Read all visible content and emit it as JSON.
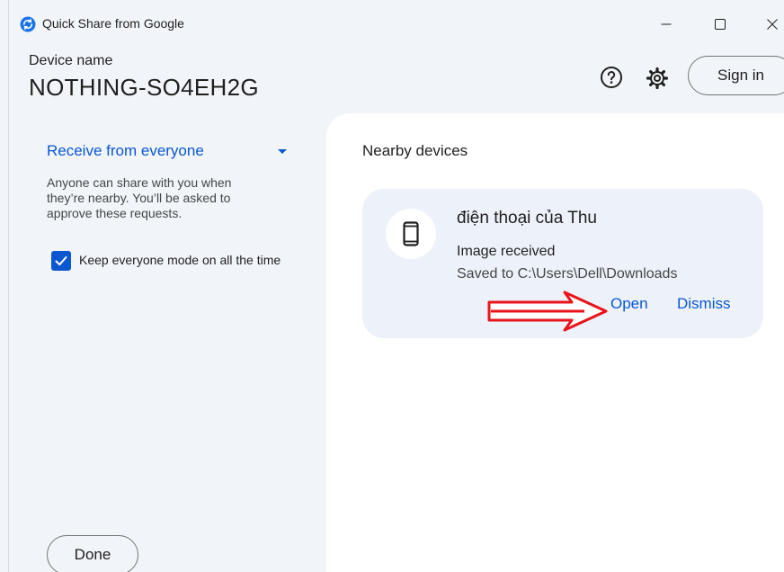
{
  "window": {
    "title": "Quick Share from Google",
    "controls": {
      "minimize": "—",
      "maximize": "☐",
      "close": "✕"
    }
  },
  "header": {
    "device_label": "Device name",
    "device_name": "NOTHING-SO4EH2G",
    "help_icon": "help-circle-icon",
    "settings_icon": "gear-icon",
    "sign_in_label": "Sign in"
  },
  "left_pane": {
    "visibility": {
      "label": "Receive from everyone",
      "icon": "caret-down-icon"
    },
    "description_lines": [
      "Anyone can share with you when",
      "they’re nearby. You’ll be asked to",
      "approve these requests."
    ],
    "keep_everyone": {
      "label": "Keep everyone mode on all the time",
      "checked": true
    },
    "done_label": "Done"
  },
  "right_pane": {
    "nearby_title": "Nearby devices",
    "card": {
      "device_name": "điện thoại của Thu",
      "device_icon": "smartphone-icon",
      "status": "Image received",
      "saved_to": "Saved to C:\\Users\\Dell\\Downloads",
      "open_label": "Open",
      "dismiss_label": "Dismiss"
    }
  },
  "colors": {
    "accent": "#0b57d0",
    "window_bg": "#f1f4f9",
    "card_bg": "#edf2fa",
    "annotation_arrow": "#e8141b"
  }
}
